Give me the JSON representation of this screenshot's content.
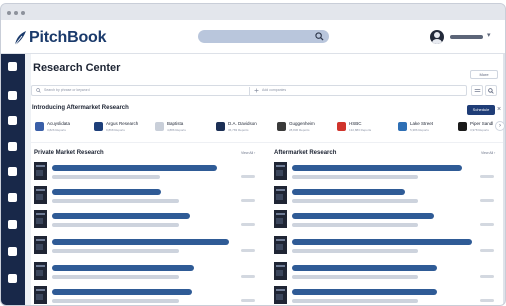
{
  "brand": {
    "name": "PitchBook",
    "color": "#1a3a6b"
  },
  "header": {
    "search_icon": "search-icon",
    "chevron": "▾"
  },
  "page": {
    "title": "Research Center",
    "more_label": "More"
  },
  "filters": {
    "search_placeholder": "Search by phrase or keyword",
    "companies_placeholder": "Add companies"
  },
  "intro": {
    "title": "Introducing Aftermarket Research",
    "schedule_label": "Schedule",
    "close_label": "×",
    "next_label": "›",
    "providers": [
      {
        "name": "Acuyslidata",
        "count": "3,826 Reports",
        "color": "#3a5fa8"
      },
      {
        "name": "Argus Research",
        "count": "9,868 Reports",
        "color": "#1e3f7a"
      },
      {
        "name": "Baptista",
        "count": "4,886 Reports",
        "color": "#c9cfd9"
      },
      {
        "name": "D.A. Davidson",
        "count": "36,783 Reports",
        "color": "#1c2f55"
      },
      {
        "name": "Guggenheim",
        "count": "28,836 Reports",
        "color": "#3a3a3a"
      },
      {
        "name": "HSBC",
        "count": "132,883 Reports",
        "color": "#d0342c"
      },
      {
        "name": "Lake Street",
        "count": "5,386 Reports",
        "color": "#2e6fb5"
      },
      {
        "name": "Piper Sandl",
        "count": "3,978 Reports",
        "color": "#1a1a1a"
      }
    ]
  },
  "sections": {
    "private": {
      "title": "Private Market Research",
      "view_all": "View All ›"
    },
    "aftermarket": {
      "title": "Aftermarket Research",
      "view_all": "View All ›"
    }
  },
  "colors": {
    "sidebar": "#182849",
    "accent": "#1f3d77",
    "headline_bar": "#2f5b96"
  }
}
